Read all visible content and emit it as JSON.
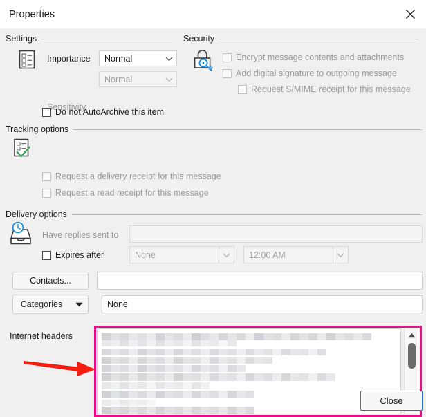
{
  "window": {
    "title": "Properties",
    "close_icon": "close-icon"
  },
  "settings": {
    "legend": "Settings",
    "icon": "form-list-icon",
    "importance": {
      "label": "Importance",
      "value": "Normal",
      "enabled": true
    },
    "sensitivity": {
      "label": "Sensitivity",
      "value": "Normal",
      "enabled": false
    },
    "autoarchive": {
      "label": "Do not AutoArchive this item",
      "checked": false,
      "enabled": true
    }
  },
  "security": {
    "legend": "Security",
    "icon": "lock-key-icon",
    "options": [
      {
        "label": "Encrypt message contents and attachments",
        "checked": false,
        "enabled": false
      },
      {
        "label": "Add digital signature to outgoing message",
        "checked": false,
        "enabled": false
      },
      {
        "label": "Request S/MIME receipt for this message",
        "checked": false,
        "enabled": false
      }
    ]
  },
  "tracking": {
    "legend": "Tracking options",
    "icon": "document-check-icon",
    "options": [
      {
        "label": "Request a delivery receipt for this message",
        "checked": false,
        "enabled": false
      },
      {
        "label": "Request a read receipt for this message",
        "checked": false,
        "enabled": false
      }
    ]
  },
  "delivery": {
    "legend": "Delivery options",
    "icon": "inbox-clock-icon",
    "have_replies": {
      "label": "Have replies sent to",
      "value": "",
      "enabled": false
    },
    "expires": {
      "label": "Expires after",
      "checked": false,
      "date_value": "None",
      "time_value": "12:00 AM",
      "enabled": false
    },
    "contacts": {
      "button_label": "Contacts...",
      "value": ""
    },
    "categories": {
      "button_label": "Categories",
      "caret_icon": "caret-down-icon",
      "value": "None"
    }
  },
  "internet_headers": {
    "label": "Internet headers",
    "content_state": "blurred",
    "highlight_color": "#ee0b8a",
    "annotation_arrow": {
      "icon": "red-arrow-icon",
      "color": "#f51d11"
    },
    "scrollbar": {
      "up_icon": "scroll-up-arrow-icon",
      "down_icon": "scroll-down-arrow-icon",
      "thumb": "scroll-thumb"
    }
  },
  "footer": {
    "close_label": "Close"
  }
}
